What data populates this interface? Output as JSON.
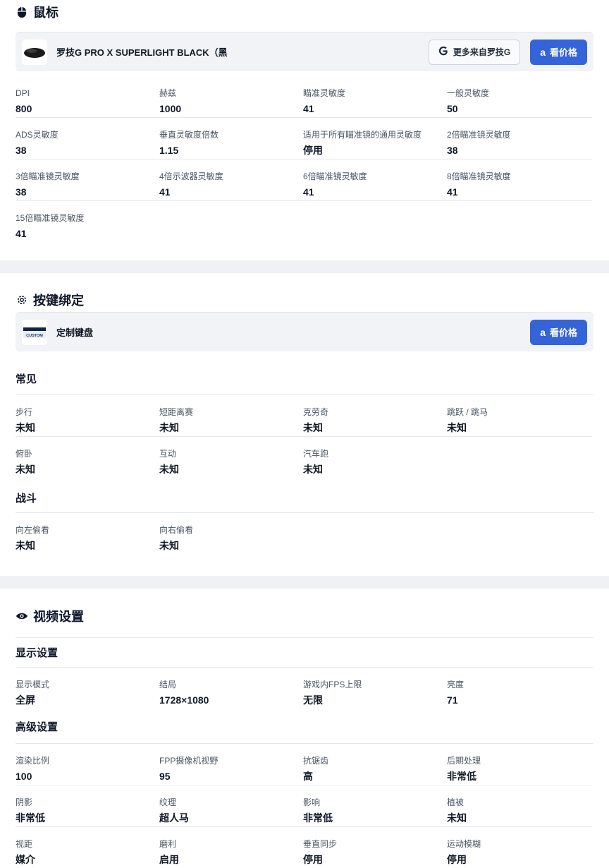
{
  "mouse": {
    "title": "鼠标",
    "product_name": "罗技G PRO X SUPERLIGHT BLACK（黑",
    "more_label": "更多来自罗技G",
    "price_label": "看价格",
    "stats": [
      {
        "label": "DPI",
        "value": "800"
      },
      {
        "label": "赫兹",
        "value": "1000"
      },
      {
        "label": "瞄准灵敏度",
        "value": "41"
      },
      {
        "label": "一般灵敏度",
        "value": "50"
      },
      {
        "label": "ADS灵敏度",
        "value": "38"
      },
      {
        "label": "垂直灵敏度倍数",
        "value": "1.15"
      },
      {
        "label": "适用于所有瞄准镜的通用灵敏度",
        "value": "停用"
      },
      {
        "label": "2倍瞄准镜灵敏度",
        "value": "38"
      },
      {
        "label": "3倍瞄准镜灵敏度",
        "value": "38"
      },
      {
        "label": "4倍示波器灵敏度",
        "value": "41"
      },
      {
        "label": "6倍瞄准镜灵敏度",
        "value": "41"
      },
      {
        "label": "8倍瞄准镜灵敏度",
        "value": "41"
      },
      {
        "label": "15倍瞄准镜灵敏度",
        "value": "41"
      }
    ]
  },
  "keybinds": {
    "title": "按键绑定",
    "product_name": "定制键盘",
    "thumb_text": "CUSTOM",
    "price_label": "看价格",
    "common_title": "常见",
    "common": [
      {
        "label": "步行",
        "value": "未知"
      },
      {
        "label": "短距离赛",
        "value": "未知"
      },
      {
        "label": "克劳奇",
        "value": "未知"
      },
      {
        "label": "跳跃 / 跳马",
        "value": "未知"
      },
      {
        "label": "俯卧",
        "value": "未知"
      },
      {
        "label": "互动",
        "value": "未知"
      },
      {
        "label": "汽车跑",
        "value": "未知"
      }
    ],
    "combat_title": "战斗",
    "combat": [
      {
        "label": "向左偷看",
        "value": "未知"
      },
      {
        "label": "向右偷看",
        "value": "未知"
      }
    ]
  },
  "video": {
    "title": "视频设置",
    "display_title": "显示设置",
    "display": [
      {
        "label": "显示模式",
        "value": "全屏"
      },
      {
        "label": "结局",
        "value": "1728×1080"
      },
      {
        "label": "游戏内FPS上限",
        "value": "无限"
      },
      {
        "label": "亮度",
        "value": "71"
      }
    ],
    "advanced_title": "高级设置",
    "advanced": [
      {
        "label": "渲染比例",
        "value": "100"
      },
      {
        "label": "FPP摄像机视野",
        "value": "95"
      },
      {
        "label": "抗锯齿",
        "value": "高"
      },
      {
        "label": "后期处理",
        "value": "非常低"
      },
      {
        "label": "阴影",
        "value": "非常低"
      },
      {
        "label": "纹理",
        "value": "超人马"
      },
      {
        "label": "影响",
        "value": "非常低"
      },
      {
        "label": "植被",
        "value": "未知"
      },
      {
        "label": "视距",
        "value": "媒介"
      },
      {
        "label": "磨利",
        "value": "启用"
      },
      {
        "label": "垂直同步",
        "value": "停用"
      },
      {
        "label": "运动模糊",
        "value": "停用"
      }
    ]
  }
}
